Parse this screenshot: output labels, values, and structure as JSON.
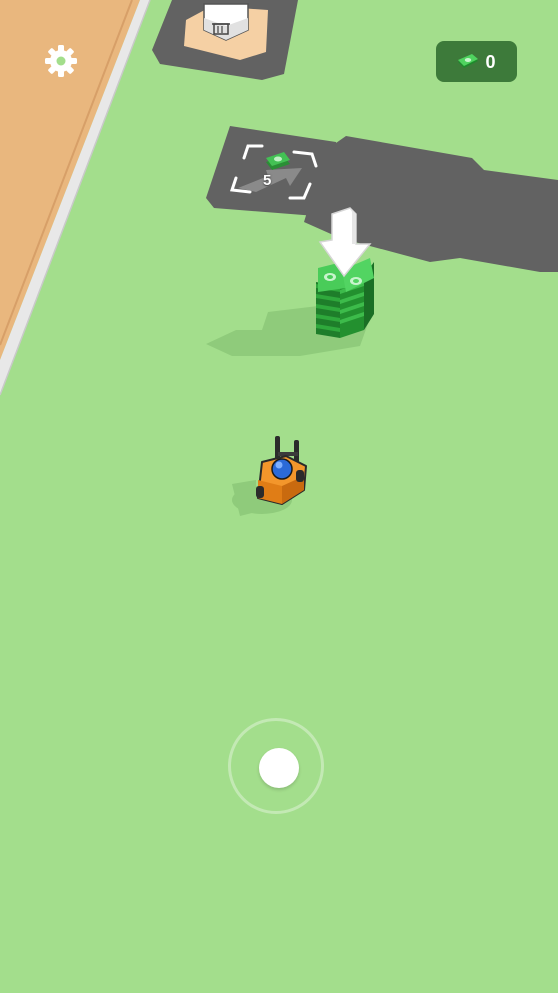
{
  "hud": {
    "cash_amount": "0",
    "settings_icon": "gear-icon",
    "cash_icon": "cash-bill-icon"
  },
  "world": {
    "purchase_spot": {
      "price_label": "5",
      "icon": "cash-bill-icon"
    },
    "trash_bin_icon": "trash-icon",
    "drop_arrow_icon": "down-arrow-icon",
    "player_vehicle": "forklift",
    "cash_stack_icon": "cash-stack-icon"
  },
  "controls": {
    "joystick": "virtual-joystick"
  },
  "colors": {
    "ground": "#a3de8c",
    "road": "#626262",
    "sand": "#e9b77e",
    "cash_green": "#2fa83c",
    "hud_pill": "#3d7a3a",
    "forklift_orange": "#f3962b",
    "driver_blue": "#2b6ad8"
  }
}
